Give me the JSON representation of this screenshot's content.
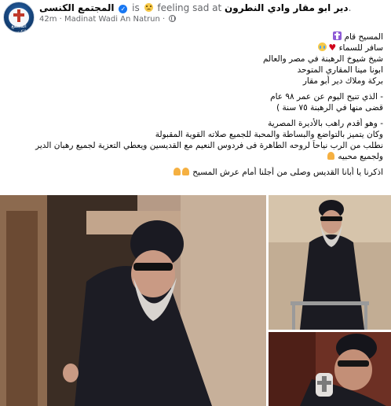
{
  "header": {
    "avatar_text": "المجتمع الكنسى",
    "page_name": "المجتمع الكنسى",
    "feeling_prefix": "is",
    "feeling_text": "feeling sad at",
    "location": "دير ابو مقار وادي النطرون",
    "location_suffix": ".",
    "time": "42m",
    "separator": "·",
    "place": "Madinat Wadi An Natrun",
    "place_suffix": "·",
    "globe_icon": "globe-icon"
  },
  "post": {
    "l1": "المسيح قام",
    "l2": "سافر للسماء",
    "l3": "شيخ شيوخ الرهبنة في مصر والعالم",
    "l4": "ابونا مينا المقاري المتوحد",
    "l5": "بركة وملاك دير أبو مقار",
    "l6": "-  الذي تنيح اليوم عن عمر ٩٨ عام",
    "l7": "قضى منها في الرهبنة ٧٥ سنة )",
    "l8": "-  وهو أقدم راهب بالأديرة المصرية",
    "l9": "وكان يتميز بالتواضع والبساطة والمحبة للجميع صلاته القوية المقبولة",
    "l10": "نطلب من الرب نياحاً لروحه الطاهرة فى فردوس النعيم مع القديسين ويعطي  التعزية لجميع رهبان الدير",
    "l11": "ولجميع محبيه",
    "l12": "اذكرنا يا أبانا القديس وصلى من أجلنا أمام عرش المسيح"
  },
  "colors": {
    "link": "#1877f2",
    "text": "#050505",
    "meta": "#65676b"
  }
}
